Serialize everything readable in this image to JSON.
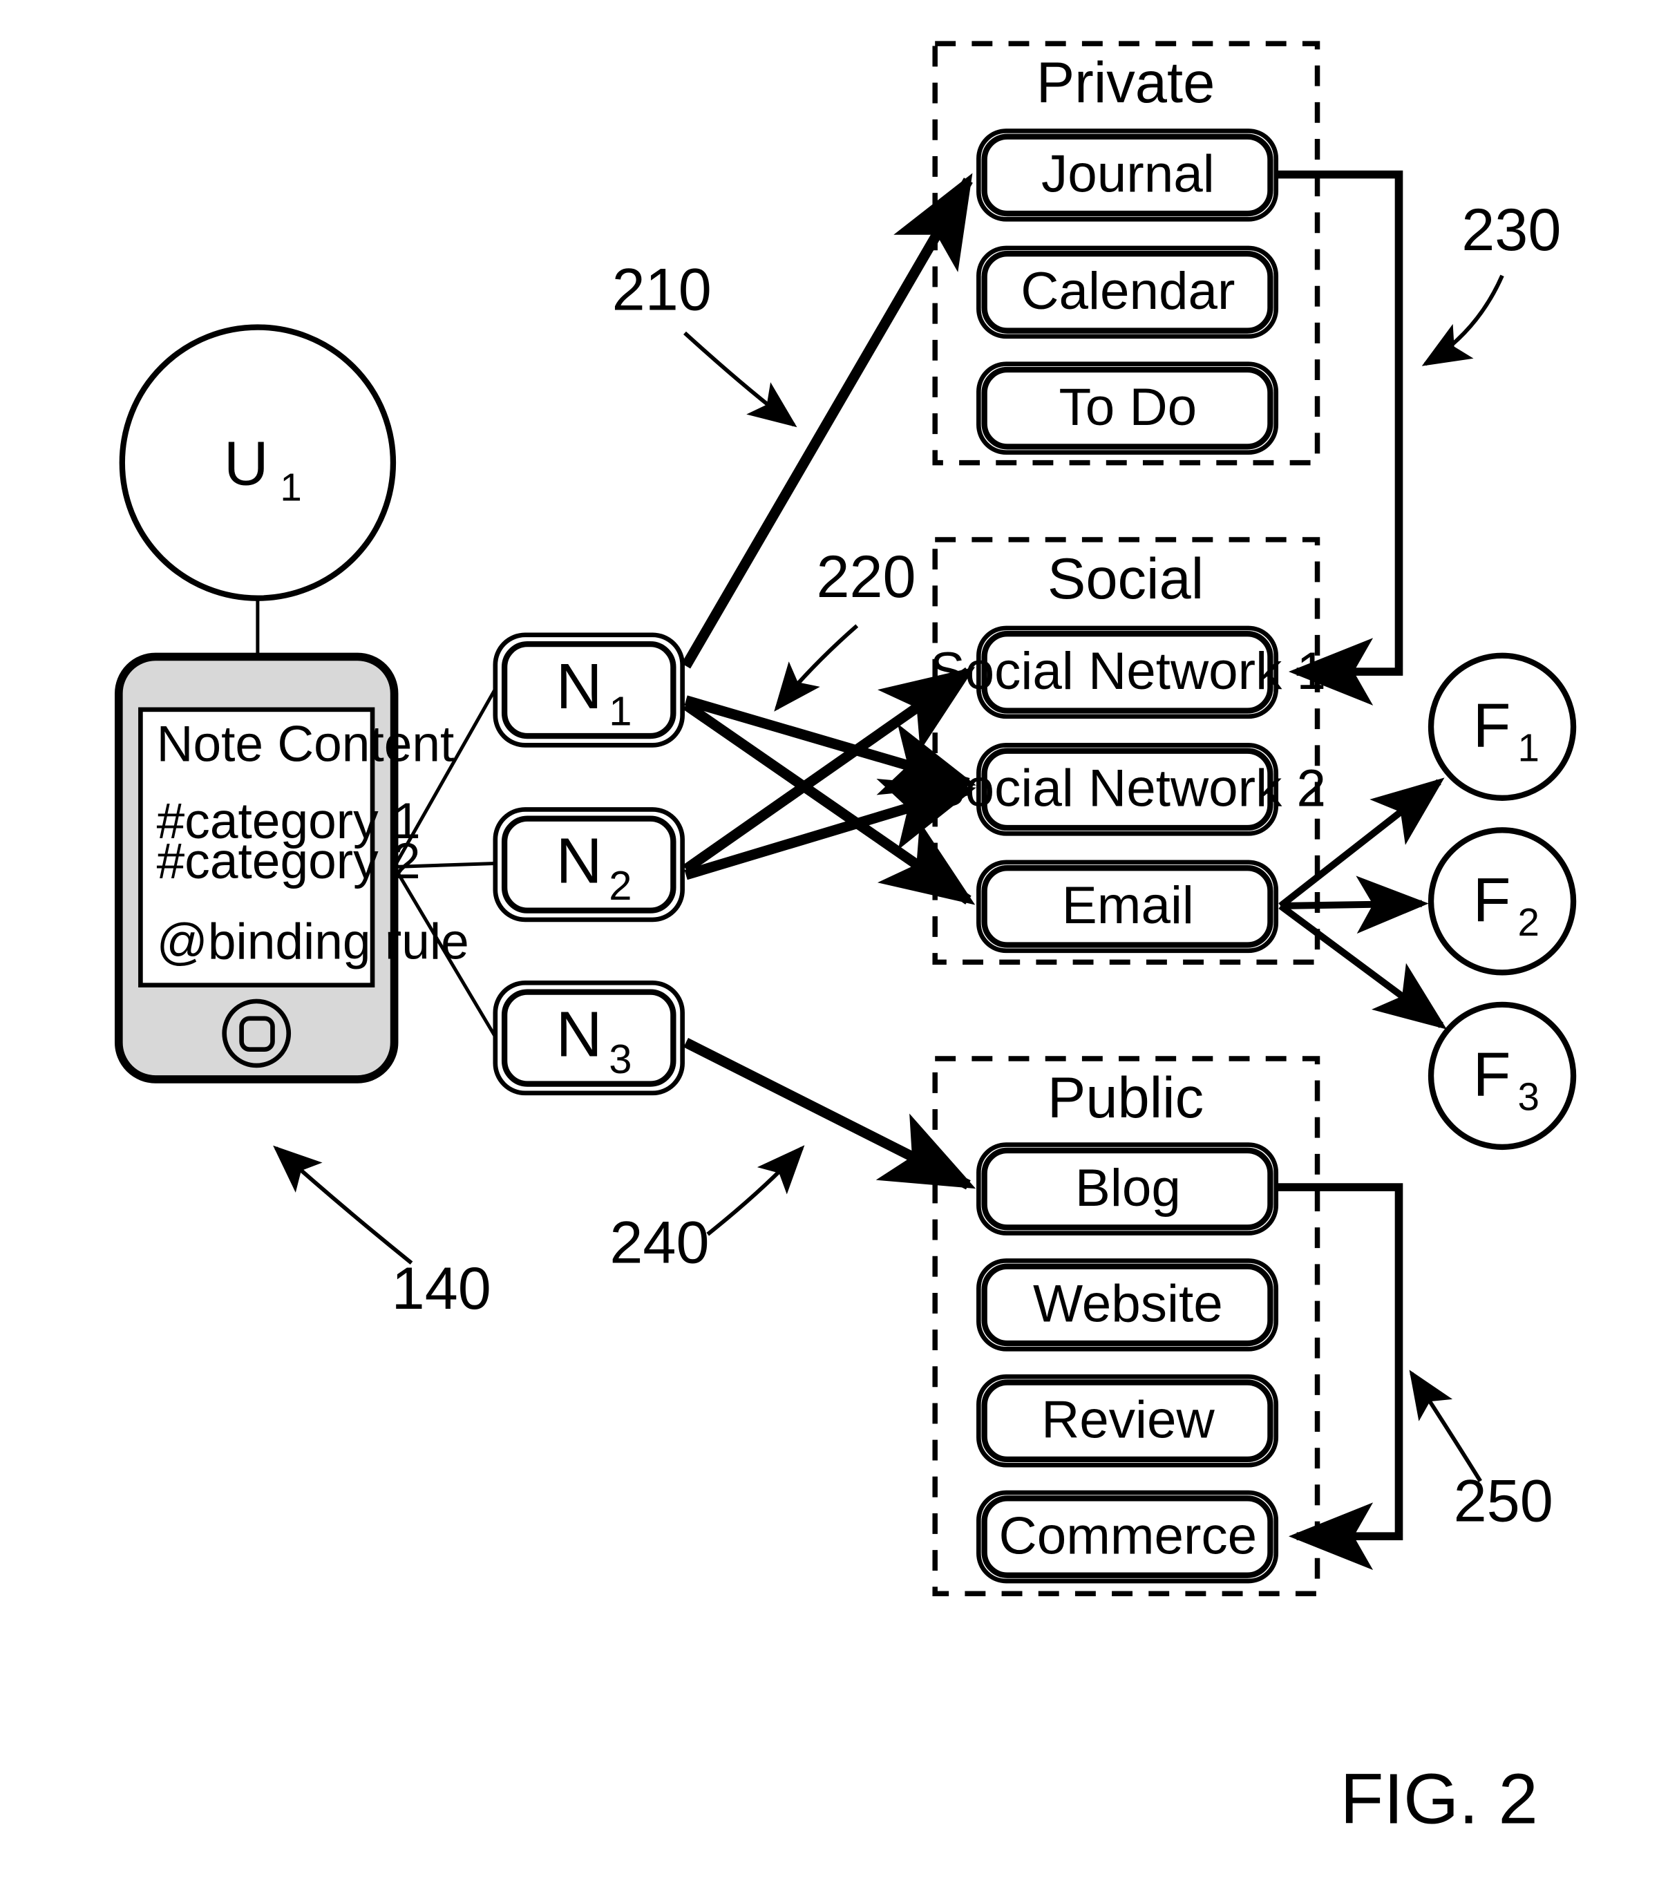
{
  "figure": {
    "caption": "FIG. 2"
  },
  "user_node": {
    "label": "U",
    "subscript": "1"
  },
  "device": {
    "ref": "140",
    "note_title": "Note Content",
    "note_lines": [
      "#category 1",
      "#category 2",
      "@binding rule"
    ]
  },
  "notes": [
    {
      "label": "N",
      "subscript": "1"
    },
    {
      "label": "N",
      "subscript": "2"
    },
    {
      "label": "N",
      "subscript": "3"
    }
  ],
  "groups": [
    {
      "title": "Private",
      "ref": "230",
      "items": [
        "Journal",
        "Calendar",
        "To Do"
      ]
    },
    {
      "title": "Social",
      "ref": "",
      "items": [
        "Social Network 1",
        "Social Network 2",
        "Email"
      ]
    },
    {
      "title": "Public",
      "ref": "250",
      "items": [
        "Blog",
        "Website",
        "Review",
        "Commerce"
      ]
    }
  ],
  "friends": [
    {
      "label": "F",
      "subscript": "1"
    },
    {
      "label": "F",
      "subscript": "2"
    },
    {
      "label": "F",
      "subscript": "3"
    }
  ],
  "reference_numerals": {
    "r210": "210",
    "r220": "220",
    "r230": "230",
    "r240": "240",
    "r250": "250",
    "r140": "140"
  },
  "colors": {
    "stroke": "#000000",
    "background": "#ffffff",
    "device_fill": "#d8d8d8"
  }
}
